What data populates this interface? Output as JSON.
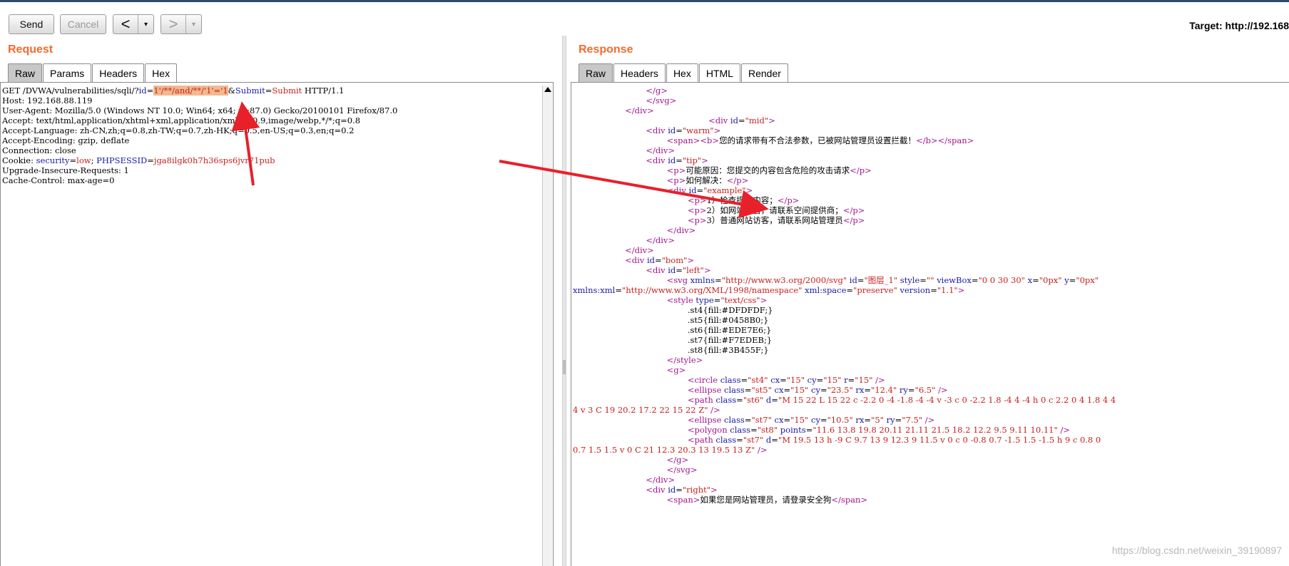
{
  "toolbar": {
    "send_label": "Send",
    "cancel_label": "Cancel",
    "back_arrow": "<",
    "forward_arrow": ">",
    "dropdown_glyph": "▾",
    "target_label": "Target: http://192.168"
  },
  "request": {
    "title": "Request",
    "tabs": [
      "Raw",
      "Params",
      "Headers",
      "Hex"
    ],
    "active_tab": "Raw",
    "line1": {
      "prefix": "GET /DVWA/vulnerabilities/sqli/?",
      "p1_name": "id",
      "eq": "=",
      "p1_value": "1'/**/and/**/'1'='1",
      "amp": "&",
      "p2_name": "Submit",
      "p2_value": "Submit",
      "suffix": " HTTP/1.1"
    },
    "headers": [
      "Host: 192.168.88.119",
      "User-Agent: Mozilla/5.0 (Windows NT 10.0; Win64; x64; rv:87.0) Gecko/20100101 Firefox/87.0",
      "Accept: text/html,application/xhtml+xml,application/xml;q=0.9,image/webp,*/*;q=0.8",
      "Accept-Language: zh-CN,zh;q=0.8,zh-TW;q=0.7,zh-HK;q=0.5,en-US;q=0.3,en;q=0.2",
      "Accept-Encoding: gzip, deflate",
      "Connection: close"
    ],
    "cookie": {
      "label": "Cookie: ",
      "n1": "security",
      "v1": "low",
      "sep": "; ",
      "n2": "PHPSESSID",
      "v2": "jga8ilgk0h7h36sps6jvr71pub"
    },
    "trailing_headers": [
      "Upgrade-Insecure-Requests: 1",
      "Cache-Control: max-age=0"
    ]
  },
  "response": {
    "title": "Response",
    "tabs": [
      "Raw",
      "Headers",
      "Hex",
      "HTML",
      "Render"
    ],
    "active_tab": "Raw",
    "lines": [
      [
        [
          0,
          "                            "
        ],
        [
          1,
          "</g>"
        ]
      ],
      [
        [
          0,
          "                            "
        ],
        [
          1,
          "</svg>"
        ]
      ],
      [
        [
          0,
          "                    "
        ],
        [
          1,
          "</div>"
        ]
      ],
      [
        [
          0,
          "                                                    "
        ],
        [
          1,
          "<div "
        ],
        [
          2,
          "id"
        ],
        [
          0,
          "="
        ],
        [
          3,
          "\"mid\""
        ],
        [
          1,
          ">"
        ]
      ],
      [
        [
          0,
          "                            "
        ],
        [
          1,
          "<div "
        ],
        [
          2,
          "id"
        ],
        [
          0,
          "="
        ],
        [
          3,
          "\"warm\""
        ],
        [
          1,
          ">"
        ]
      ],
      [
        [
          0,
          "                                    "
        ],
        [
          1,
          "<span>"
        ],
        [
          1,
          "<b>"
        ],
        [
          0,
          "您的请求带有不合法参数，已被网站管理员设置拦截！"
        ],
        [
          1,
          "</b>"
        ],
        [
          1,
          "</span>"
        ]
      ],
      [
        [
          0,
          "                            "
        ],
        [
          1,
          "</div>"
        ]
      ],
      [
        [
          0,
          "                            "
        ],
        [
          1,
          "<div "
        ],
        [
          2,
          "id"
        ],
        [
          0,
          "="
        ],
        [
          3,
          "\"tip\""
        ],
        [
          1,
          ">"
        ]
      ],
      [
        [
          0,
          "                                    "
        ],
        [
          1,
          "<p>"
        ],
        [
          0,
          "可能原因：您提交的内容包含危险的攻击请求"
        ],
        [
          1,
          "</p>"
        ]
      ],
      [
        [
          0,
          "                                    "
        ],
        [
          1,
          "<p>"
        ],
        [
          0,
          "如何解决："
        ],
        [
          1,
          "</p>"
        ]
      ],
      [
        [
          0,
          "                                    "
        ],
        [
          1,
          "<div "
        ],
        [
          2,
          "id"
        ],
        [
          0,
          "="
        ],
        [
          3,
          "\"example\""
        ],
        [
          1,
          ">"
        ]
      ],
      [
        [
          0,
          "                                            "
        ],
        [
          1,
          "<p>"
        ],
        [
          0,
          "1）检查提交内容；"
        ],
        [
          1,
          "</p>"
        ]
      ],
      [
        [
          0,
          "                                            "
        ],
        [
          1,
          "<p>"
        ],
        [
          0,
          "2）如网站托管，请联系空间提供商；"
        ],
        [
          1,
          "</p>"
        ]
      ],
      [
        [
          0,
          "                                            "
        ],
        [
          1,
          "<p>"
        ],
        [
          0,
          "3）普通网站访客，请联系网站管理员"
        ],
        [
          1,
          "</p>"
        ]
      ],
      [
        [
          0,
          "                                    "
        ],
        [
          1,
          "</div>"
        ]
      ],
      [
        [
          0,
          "                            "
        ],
        [
          1,
          "</div>"
        ]
      ],
      [
        [
          0,
          "                    "
        ],
        [
          1,
          "</div>"
        ]
      ],
      [
        [
          0,
          "                    "
        ],
        [
          1,
          "<div "
        ],
        [
          2,
          "id"
        ],
        [
          0,
          "="
        ],
        [
          3,
          "\"bom\""
        ],
        [
          1,
          ">"
        ]
      ],
      [
        [
          0,
          "                            "
        ],
        [
          1,
          "<div "
        ],
        [
          2,
          "id"
        ],
        [
          0,
          "="
        ],
        [
          3,
          "\"left\""
        ],
        [
          1,
          ">"
        ]
      ],
      [
        [
          0,
          "                                    "
        ],
        [
          1,
          "<svg "
        ],
        [
          2,
          "xmlns"
        ],
        [
          0,
          "="
        ],
        [
          3,
          "\"http://www.w3.org/2000/svg\""
        ],
        [
          0,
          " "
        ],
        [
          2,
          "id"
        ],
        [
          0,
          "="
        ],
        [
          3,
          "\"图层_1\""
        ],
        [
          0,
          " "
        ],
        [
          2,
          "style"
        ],
        [
          0,
          "="
        ],
        [
          3,
          "\"\""
        ],
        [
          0,
          " "
        ],
        [
          2,
          "viewBox"
        ],
        [
          0,
          "="
        ],
        [
          3,
          "\"0 0 30 30\""
        ],
        [
          0,
          " "
        ],
        [
          2,
          "x"
        ],
        [
          0,
          "="
        ],
        [
          3,
          "\"0px\""
        ],
        [
          0,
          " "
        ],
        [
          2,
          "y"
        ],
        [
          0,
          "="
        ],
        [
          3,
          "\"0px\""
        ]
      ],
      [
        [
          2,
          "xmlns:xml"
        ],
        [
          0,
          "="
        ],
        [
          3,
          "\"http://www.w3.org/XML/1998/namespace\""
        ],
        [
          0,
          " "
        ],
        [
          2,
          "xml:space"
        ],
        [
          0,
          "="
        ],
        [
          3,
          "\"preserve\""
        ],
        [
          0,
          " "
        ],
        [
          2,
          "version"
        ],
        [
          0,
          "="
        ],
        [
          3,
          "\"1.1\""
        ],
        [
          1,
          ">"
        ]
      ],
      [
        [
          0,
          "                                    "
        ],
        [
          1,
          "<style "
        ],
        [
          2,
          "type"
        ],
        [
          0,
          "="
        ],
        [
          3,
          "\"text/css\""
        ],
        [
          1,
          ">"
        ]
      ],
      [
        [
          0,
          "                                            .st4{fill:#DFDFDF;}"
        ]
      ],
      [
        [
          0,
          "                                            .st5{fill:#0458B0;}"
        ]
      ],
      [
        [
          0,
          "                                            .st6{fill:#EDE7E6;}"
        ]
      ],
      [
        [
          0,
          "                                            .st7{fill:#F7EDEB;}"
        ]
      ],
      [
        [
          0,
          "                                            .st8{fill:#3B455F;}"
        ]
      ],
      [
        [
          0,
          "                                    "
        ],
        [
          1,
          "</style>"
        ]
      ],
      [
        [
          0,
          "                                    "
        ],
        [
          1,
          "<g>"
        ]
      ],
      [
        [
          0,
          "                                            "
        ],
        [
          1,
          "<circle "
        ],
        [
          2,
          "class"
        ],
        [
          0,
          "="
        ],
        [
          3,
          "\"st4\""
        ],
        [
          0,
          " "
        ],
        [
          2,
          "cx"
        ],
        [
          0,
          "="
        ],
        [
          3,
          "\"15\""
        ],
        [
          0,
          " "
        ],
        [
          2,
          "cy"
        ],
        [
          0,
          "="
        ],
        [
          3,
          "\"15\""
        ],
        [
          0,
          " "
        ],
        [
          2,
          "r"
        ],
        [
          0,
          "="
        ],
        [
          3,
          "\"15\""
        ],
        [
          0,
          " "
        ],
        [
          1,
          "/>"
        ]
      ],
      [
        [
          0,
          "                                            "
        ],
        [
          1,
          "<ellipse "
        ],
        [
          2,
          "class"
        ],
        [
          0,
          "="
        ],
        [
          3,
          "\"st5\""
        ],
        [
          0,
          " "
        ],
        [
          2,
          "cx"
        ],
        [
          0,
          "="
        ],
        [
          3,
          "\"15\""
        ],
        [
          0,
          " "
        ],
        [
          2,
          "cy"
        ],
        [
          0,
          "="
        ],
        [
          3,
          "\"23.5\""
        ],
        [
          0,
          " "
        ],
        [
          2,
          "rx"
        ],
        [
          0,
          "="
        ],
        [
          3,
          "\"12.4\""
        ],
        [
          0,
          " "
        ],
        [
          2,
          "ry"
        ],
        [
          0,
          "="
        ],
        [
          3,
          "\"6.5\""
        ],
        [
          0,
          " "
        ],
        [
          1,
          "/>"
        ]
      ],
      [
        [
          0,
          "                                            "
        ],
        [
          1,
          "<path "
        ],
        [
          2,
          "class"
        ],
        [
          0,
          "="
        ],
        [
          3,
          "\"st6\""
        ],
        [
          0,
          " "
        ],
        [
          2,
          "d"
        ],
        [
          0,
          "="
        ],
        [
          3,
          "\"M 15 22 L 15 22 c -2.2 0 -4 -1.8 -4 -4 v -3 c 0 -2.2 1.8 -4 4 -4 h 0 c 2.2 0 4 1.8 4 4"
        ]
      ],
      [
        [
          3,
          "4 v 3 C 19 20.2 17.2 22 15 22 Z\""
        ],
        [
          0,
          " "
        ],
        [
          1,
          "/>"
        ]
      ],
      [
        [
          0,
          "                                            "
        ],
        [
          1,
          "<ellipse "
        ],
        [
          2,
          "class"
        ],
        [
          0,
          "="
        ],
        [
          3,
          "\"st7\""
        ],
        [
          0,
          " "
        ],
        [
          2,
          "cx"
        ],
        [
          0,
          "="
        ],
        [
          3,
          "\"15\""
        ],
        [
          0,
          " "
        ],
        [
          2,
          "cy"
        ],
        [
          0,
          "="
        ],
        [
          3,
          "\"10.5\""
        ],
        [
          0,
          " "
        ],
        [
          2,
          "rx"
        ],
        [
          0,
          "="
        ],
        [
          3,
          "\"5\""
        ],
        [
          0,
          " "
        ],
        [
          2,
          "ry"
        ],
        [
          0,
          "="
        ],
        [
          3,
          "\"7.5\""
        ],
        [
          0,
          " "
        ],
        [
          1,
          "/>"
        ]
      ],
      [
        [
          0,
          "                                            "
        ],
        [
          1,
          "<polygon "
        ],
        [
          2,
          "class"
        ],
        [
          0,
          "="
        ],
        [
          3,
          "\"st8\""
        ],
        [
          0,
          " "
        ],
        [
          2,
          "points"
        ],
        [
          0,
          "="
        ],
        [
          3,
          "\"11.6 13.8 19.8 20.11 21.11 21.5 18.2 12.2 9.5 9.11 10.11\""
        ],
        [
          0,
          " "
        ],
        [
          1,
          "/>"
        ]
      ],
      [
        [
          0,
          "                                            "
        ],
        [
          1,
          "<path "
        ],
        [
          2,
          "class"
        ],
        [
          0,
          "="
        ],
        [
          3,
          "\"st7\""
        ],
        [
          0,
          " "
        ],
        [
          2,
          "d"
        ],
        [
          0,
          "="
        ],
        [
          3,
          "\"M 19.5 13 h -9 C 9.7 13 9 12.3 9 11.5 v 0 c 0 -0.8 0.7 -1.5 1.5 -1.5 h 9 c 0.8 0"
        ]
      ],
      [
        [
          3,
          "0.7 1.5 1.5 v 0 C 21 12.3 20.3 13 19.5 13 Z\""
        ],
        [
          0,
          " "
        ],
        [
          1,
          "/>"
        ]
      ],
      [
        [
          0,
          "                                    "
        ],
        [
          1,
          "</g>"
        ]
      ],
      [
        [
          0,
          "                                    "
        ],
        [
          1,
          "</svg>"
        ]
      ],
      [
        [
          0,
          "                            "
        ],
        [
          1,
          "</div>"
        ]
      ],
      [
        [
          0,
          "                            "
        ],
        [
          1,
          "<div "
        ],
        [
          2,
          "id"
        ],
        [
          0,
          "="
        ],
        [
          3,
          "\"right\""
        ],
        [
          1,
          ">"
        ]
      ],
      [
        [
          0,
          "                                    "
        ],
        [
          1,
          "<span>"
        ],
        [
          0,
          "如果您是网站管理员，请登录安全狗"
        ],
        [
          1,
          "</span>"
        ]
      ]
    ]
  },
  "watermark": "https://blog.csdn.net/weixin_39190897",
  "colors": {
    "accent_orange": "#f36b2b",
    "tag_color": "#a0148c",
    "attr_name_color": "#1a1aa6",
    "attr_value_color": "#c81e1e",
    "highlight": "#f3b98f",
    "annotation_arrow": "#e8202a"
  },
  "icons": [
    "back-arrow-icon",
    "forward-arrow-icon",
    "dropdown-icon",
    "scroll-up-icon",
    "annotation-arrow"
  ]
}
